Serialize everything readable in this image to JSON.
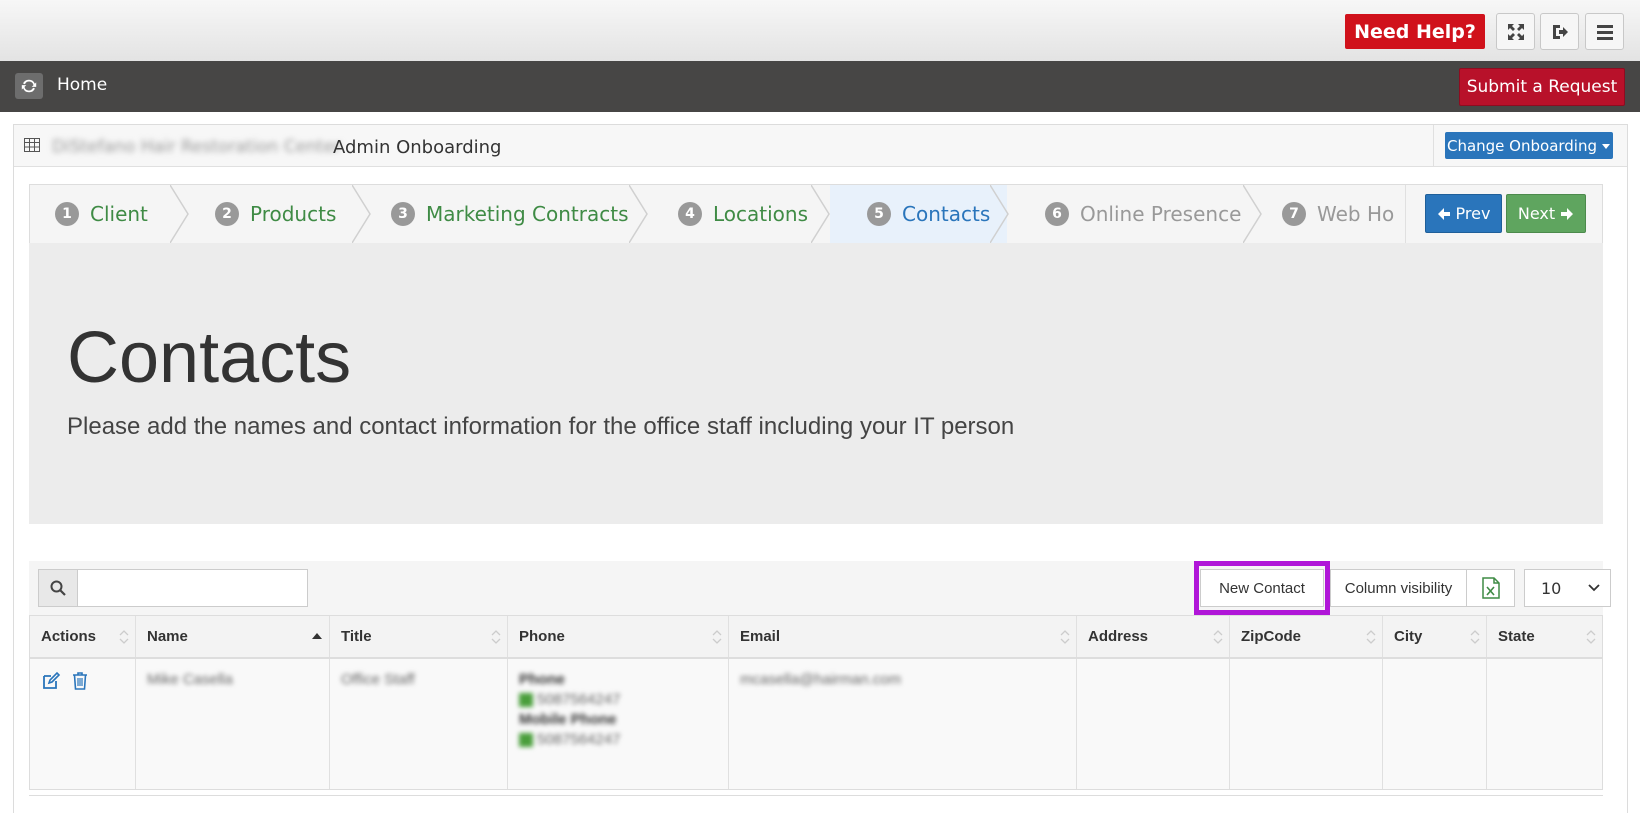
{
  "topbar": {
    "help_label": "Need Help?",
    "icons": [
      "expand-icon",
      "sign-out-icon",
      "menu-icon"
    ]
  },
  "navbar": {
    "home_label": "Home",
    "submit_label": "Submit a Request"
  },
  "panel": {
    "client_name": "DiStefano Hair Restoration Center",
    "title": "Admin Onboarding",
    "change_label": "Change Onboarding"
  },
  "wizard": {
    "steps": [
      {
        "num": "1",
        "label": "Client",
        "state": "done"
      },
      {
        "num": "2",
        "label": "Products",
        "state": "done"
      },
      {
        "num": "3",
        "label": "Marketing Contracts",
        "state": "done"
      },
      {
        "num": "4",
        "label": "Locations",
        "state": "done"
      },
      {
        "num": "5",
        "label": "Contacts",
        "state": "active"
      },
      {
        "num": "6",
        "label": "Online Presence",
        "state": "future"
      },
      {
        "num": "7",
        "label": "Web Ho",
        "state": "future"
      }
    ],
    "prev_label": "Prev",
    "next_label": "Next"
  },
  "hero": {
    "title": "Contacts",
    "subtitle": "Please add the names and contact information for the office staff including your IT person"
  },
  "toolbar": {
    "search_value": "",
    "new_contact_label": "New Contact",
    "column_visibility_label": "Column visibility",
    "page_length": "10"
  },
  "table": {
    "columns": [
      "Actions",
      "Name",
      "Title",
      "Phone",
      "Email",
      "Address",
      "ZipCode",
      "City",
      "State"
    ],
    "rows": [
      {
        "name": "Mike Casella",
        "title": "Office Staff",
        "phone_label": "Phone",
        "phone": "5087564247",
        "mobile_label": "Mobile Phone",
        "mobile": "5087564247",
        "email": "mcasella@hairman.com",
        "address": "",
        "zipcode": "",
        "city": "",
        "state": ""
      }
    ]
  },
  "colors": {
    "help_red": "#d0111b",
    "submit_red": "#b8112a",
    "nav_dark": "#474645",
    "primary_blue": "#2a75bb",
    "success_green": "#5fa55f",
    "done_step_green": "#3f8b45",
    "highlight_purple": "#b016d8"
  }
}
